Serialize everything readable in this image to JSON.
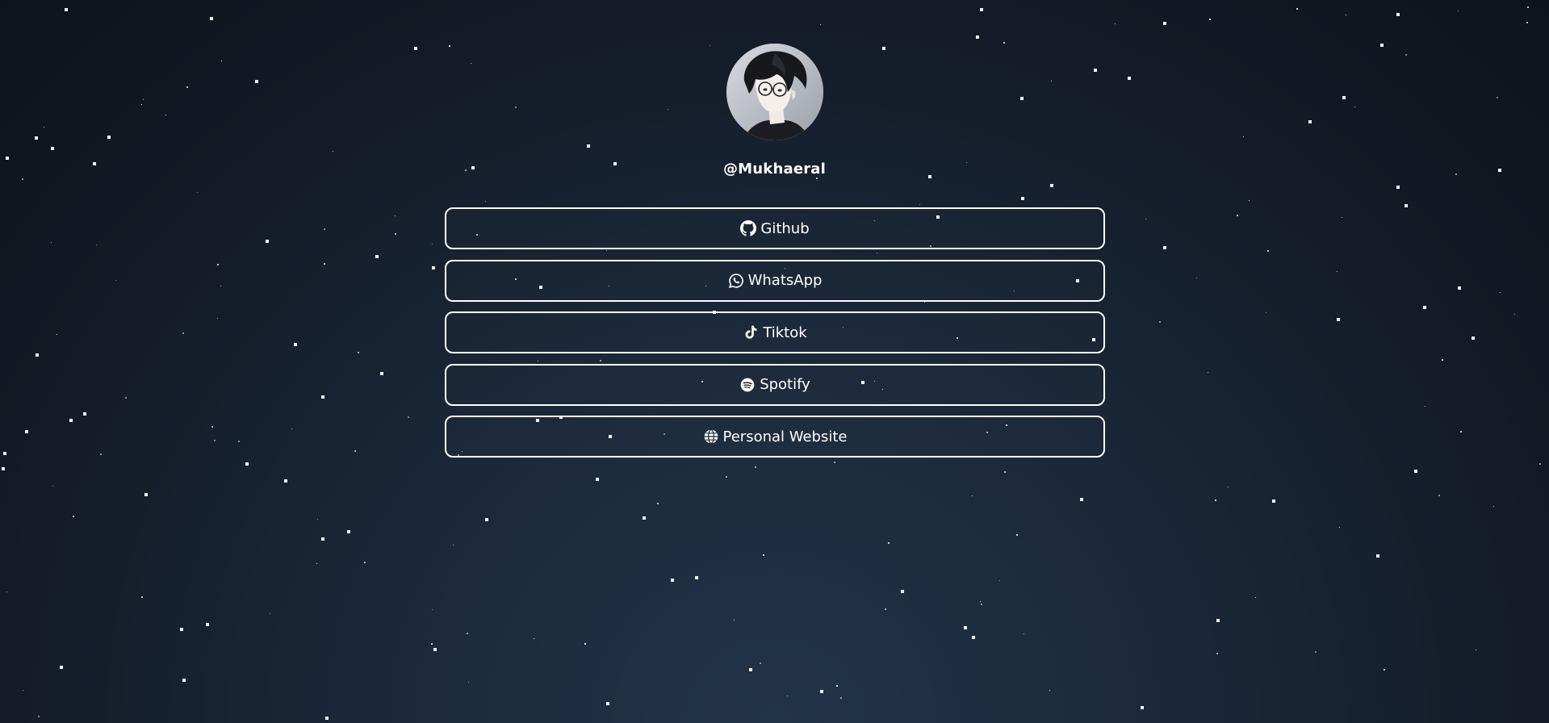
{
  "profile": {
    "username": "@Mukhaeral"
  },
  "links": [
    {
      "label": "Github",
      "icon": "github-icon"
    },
    {
      "label": "WhatsApp",
      "icon": "whatsapp-icon"
    },
    {
      "label": "Tiktok",
      "icon": "tiktok-icon"
    },
    {
      "label": "Spotify",
      "icon": "spotify-icon"
    },
    {
      "label": "Personal Website",
      "icon": "globe-icon"
    }
  ],
  "colors": {
    "background_top": "#0d131c",
    "background_bottom": "#22344a",
    "text": "#ffffff",
    "button_border": "#ffffff"
  }
}
